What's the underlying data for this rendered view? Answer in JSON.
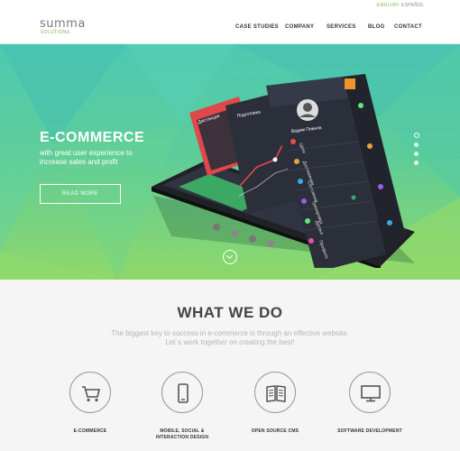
{
  "languages": [
    "English",
    "Español"
  ],
  "logo": {
    "main": "summa",
    "sub": "Solutions"
  },
  "nav": [
    "Case Studies",
    "Company",
    "Services",
    "Blog",
    "Contact"
  ],
  "hero": {
    "title": "E-COMMERCE",
    "subtitle": "with great user experience to increase sales and profit",
    "button": "Read more",
    "slide_count": 4,
    "active_slide": 1
  },
  "phone_screen": {
    "tab_left": "Дистанция",
    "tab_mid": "Подготовка",
    "user_name": "Вадим Пивнов",
    "menu": [
      "Цели",
      "Достижения",
      "Состояния",
      "Тренировка",
      "Друзья",
      "Профиль"
    ]
  },
  "what_we_do": {
    "title": "WHAT WE DO",
    "text_line1": "The biggest key to success in e-commerce is through an effective website.",
    "text_line2": "Let´s work together on creating the best!",
    "services": [
      {
        "icon": "cart-icon",
        "label": "E-Commerce"
      },
      {
        "icon": "mobile-icon",
        "label": "Mobile, Social & Interaction Design"
      },
      {
        "icon": "book-icon",
        "label": "Open Source CMS"
      },
      {
        "icon": "monitor-icon",
        "label": "Software Development"
      }
    ]
  },
  "colors": {
    "accent": "#7ab342",
    "hero_top": "#4ec9b2",
    "hero_bottom": "#8fd86a",
    "app_red": "#e0484a",
    "app_dark": "#2b2f3a"
  }
}
